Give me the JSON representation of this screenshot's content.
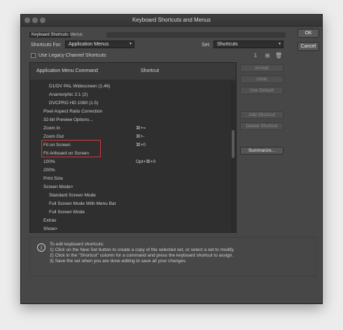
{
  "window": {
    "title": "Keyboard Shortcuts and Menus"
  },
  "tabs": [
    {
      "label": "Keyboard Shortcuts"
    },
    {
      "label": "Menus"
    }
  ],
  "shortcuts_for": {
    "label": "Shortcuts For:",
    "value": "Application Menus"
  },
  "set": {
    "label": "Set:",
    "value": "Shortcuts"
  },
  "legacy": {
    "label": "Use Legacy Channel Shortcuts"
  },
  "icons": [
    "save-set-icon",
    "new-set-icon",
    "delete-set-icon"
  ],
  "table": {
    "col_command": "Application Menu Command",
    "col_shortcut": "Shortcut",
    "rows": [
      {
        "command": "D1/DV PAL Widescreen (1.46)",
        "shortcut": "",
        "level": 2
      },
      {
        "command": "Anamorphic 2:1 (2)",
        "shortcut": "",
        "level": 2
      },
      {
        "command": "DVCPRO HD 1080 (1.5)",
        "shortcut": "",
        "level": 2
      },
      {
        "command": "Pixel Aspect Ratio Correction",
        "shortcut": "",
        "level": 1
      },
      {
        "command": "32-bit Preview Options...",
        "shortcut": "",
        "level": 1
      },
      {
        "command": "Zoom In",
        "shortcut": "⌘+=",
        "level": 1
      },
      {
        "command": "Zoom Out",
        "shortcut": "⌘+-",
        "level": 1
      },
      {
        "command": "Fit on Screen",
        "shortcut": "⌘+0",
        "level": 1
      },
      {
        "command": "Fit Artboard on Screen",
        "shortcut": "",
        "level": 1
      },
      {
        "command": "100%",
        "shortcut": "Opt+⌘+0",
        "level": 1
      },
      {
        "command": "200%",
        "shortcut": "",
        "level": 1
      },
      {
        "command": "Print Size",
        "shortcut": "",
        "level": 1
      },
      {
        "command": "Screen Mode>",
        "shortcut": "",
        "level": 1
      },
      {
        "command": "Standard Screen Mode",
        "shortcut": "",
        "level": 2
      },
      {
        "command": "Full Screen Mode With Menu Bar",
        "shortcut": "",
        "level": 2
      },
      {
        "command": "Full Screen Mode",
        "shortcut": "",
        "level": 2
      },
      {
        "command": "Extras",
        "shortcut": "",
        "level": 1
      },
      {
        "command": "Show>",
        "shortcut": "",
        "level": 1
      }
    ]
  },
  "side_buttons": {
    "accept": "Accept",
    "undo": "Undo",
    "use_default": "Use Default",
    "add_shortcut": "Add Shortcut",
    "delete_shortcut": "Delete Shortcut",
    "summarize": "Summarize..."
  },
  "dialog_buttons": {
    "ok": "OK",
    "cancel": "Cancel"
  },
  "info": {
    "heading": "To edit keyboard shortcuts:",
    "lines": [
      "1) Click on the New Set button to create a copy of the selected set, or select a set to modify.",
      "2) Click in the \"Shortcut\" column for a command and press the keyboard shortcut to assign.",
      "3) Save the set when you are done editing to save all your changes."
    ]
  },
  "colors": {
    "highlight": "#d9363e",
    "panel": "#474747",
    "list_bg": "#2f2f2f"
  }
}
